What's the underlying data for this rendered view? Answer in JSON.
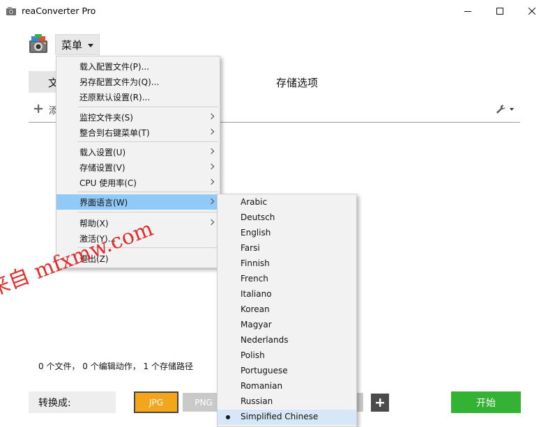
{
  "window": {
    "title": "reaConverter Pro"
  },
  "header": {
    "menu_label": "菜单"
  },
  "tabs": {
    "left_partial": "文",
    "storage": "存储选项"
  },
  "toolbar": {
    "add_partial": "添"
  },
  "main_menu": {
    "items": [
      {
        "label": "载入配置文件(P)...",
        "submenu": false
      },
      {
        "label": "另存配置文件为(Q)...",
        "submenu": false
      },
      {
        "label": "还原默认设置(R)...",
        "submenu": false
      },
      {
        "label": "监控文件夹(S)",
        "submenu": true
      },
      {
        "label": "整合到右键菜单(T)",
        "submenu": true
      },
      {
        "label": "载入设置(U)",
        "submenu": true
      },
      {
        "label": "存储设置(V)",
        "submenu": true
      },
      {
        "label": "CPU 使用率(C)",
        "submenu": true
      },
      {
        "label": "界面语言(W)",
        "submenu": true,
        "highlighted": true
      },
      {
        "label": "帮助(X)",
        "submenu": true
      },
      {
        "label": "激活(Y)...",
        "submenu": false
      },
      {
        "label": "退出(Z)",
        "submenu": false
      }
    ]
  },
  "language_menu": {
    "items": [
      "Arabic",
      "Deutsch",
      "English",
      "Farsi",
      "Finnish",
      "French",
      "Italiano",
      "Korean",
      "Magyar",
      "Nederlands",
      "Polish",
      "Portuguese",
      "Romanian",
      "Russian",
      "Simplified Chinese"
    ],
    "selected": "Simplified Chinese"
  },
  "status": {
    "text": "0 个文件， 0 个编辑动作， 1 个存储路径"
  },
  "footer": {
    "convert_label": "转换成:",
    "formats": [
      "JPG",
      "PNG"
    ],
    "start_label": "开始"
  },
  "watermark": {
    "text": "来自 mfxmw.com"
  },
  "colors": {
    "highlight": "#91c9f7",
    "jpg_accent": "#f3a51b",
    "start_green": "#34b233"
  }
}
